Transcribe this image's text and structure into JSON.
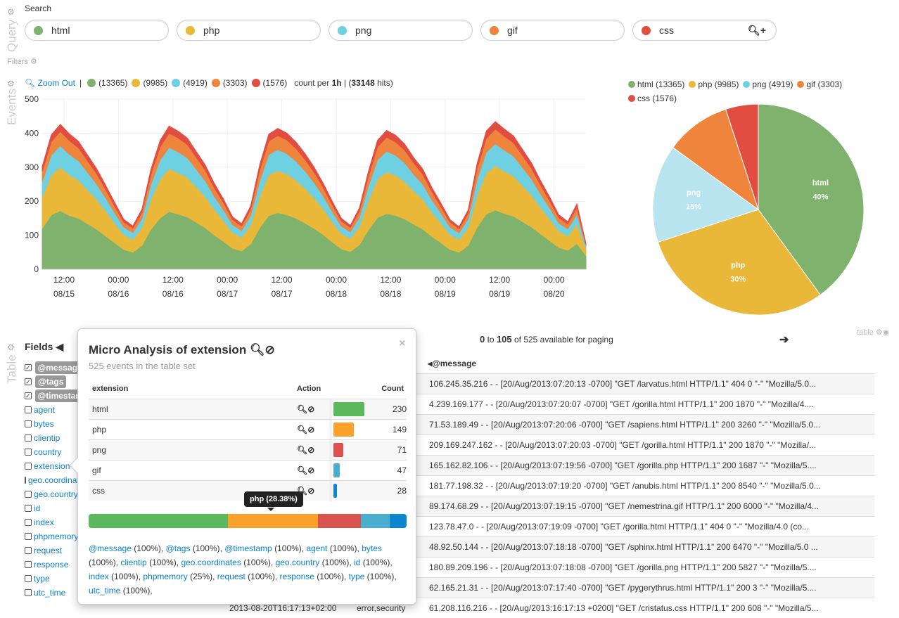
{
  "query": {
    "label": "Query",
    "search_label": "Search",
    "filters_label": "Filters",
    "pills": [
      {
        "text": "html",
        "color": "#7eb26d"
      },
      {
        "text": "php",
        "color": "#eab839"
      },
      {
        "text": "png",
        "color": "#6ed0e0"
      },
      {
        "text": "gif",
        "color": "#ef843c"
      },
      {
        "text": "css",
        "color": "#e24d42"
      }
    ]
  },
  "events": {
    "label": "Events",
    "zoom_out": "Zoom Out",
    "counts": [
      "(13365)",
      "(9985)",
      "(4919)",
      "(3303)",
      "(1576)"
    ],
    "count_per": "count per ",
    "interval": "1h",
    "hits_pre": "(",
    "hits": "33148",
    "hits_post": " hits)"
  },
  "chart_data": [
    {
      "type": "area",
      "stacked": true,
      "interval": "1h",
      "ylim": [
        0,
        500
      ],
      "yticks": [
        0,
        100,
        200,
        300,
        400,
        500
      ],
      "xticks": [
        [
          "12:00",
          "08/15"
        ],
        [
          "00:00",
          "08/16"
        ],
        [
          "12:00",
          "08/16"
        ],
        [
          "00:00",
          "08/17"
        ],
        [
          "12:00",
          "08/17"
        ],
        [
          "00:00",
          "08/18"
        ],
        [
          "12:00",
          "08/18"
        ],
        [
          "00:00",
          "08/19"
        ],
        [
          "12:00",
          "08/19"
        ],
        [
          "00:00",
          "08/20"
        ]
      ],
      "grid": true,
      "x_start": "08/15 07:00",
      "x_step_hours": 2,
      "series": [
        {
          "name": "html",
          "color": "#7eb26d",
          "values": [
            120,
            160,
            172,
            158,
            150,
            134,
            118,
            98,
            78,
            58,
            50,
            70,
            118,
            150,
            170,
            162,
            154,
            138,
            122,
            100,
            82,
            62,
            54,
            74,
            122,
            158,
            166,
            160,
            150,
            136,
            120,
            102,
            80,
            60,
            52,
            72,
            116,
            152,
            164,
            158,
            148,
            132,
            118,
            96,
            78,
            58,
            50,
            70,
            124,
            162,
            174,
            164,
            156,
            140,
            124,
            104,
            84,
            64,
            56,
            76,
            40
          ]
        },
        {
          "name": "php",
          "color": "#eab839",
          "values": [
            92,
            118,
            128,
            120,
            112,
            100,
            88,
            74,
            58,
            44,
            38,
            52,
            88,
            114,
            126,
            122,
            116,
            104,
            92,
            76,
            62,
            46,
            40,
            56,
            92,
            120,
            124,
            120,
            112,
            102,
            90,
            76,
            60,
            45,
            39,
            54,
            86,
            114,
            122,
            118,
            110,
            98,
            88,
            72,
            58,
            44,
            38,
            52,
            94,
            122,
            130,
            124,
            118,
            106,
            94,
            78,
            64,
            48,
            42,
            58,
            20
          ]
        },
        {
          "name": "png",
          "color": "#6ed0e0",
          "values": [
            45,
            58,
            63,
            60,
            57,
            51,
            45,
            38,
            30,
            22,
            20,
            27,
            44,
            57,
            62,
            61,
            58,
            52,
            46,
            38,
            31,
            23,
            20,
            28,
            46,
            59,
            62,
            60,
            56,
            51,
            45,
            38,
            30,
            22,
            19,
            27,
            43,
            56,
            61,
            59,
            55,
            49,
            44,
            36,
            29,
            22,
            19,
            26,
            47,
            60,
            65,
            62,
            59,
            53,
            47,
            39,
            32,
            24,
            21,
            29,
            8
          ]
        },
        {
          "name": "gif",
          "color": "#ef843c",
          "values": [
            30,
            39,
            42,
            40,
            38,
            34,
            30,
            25,
            20,
            15,
            13,
            18,
            29,
            38,
            42,
            41,
            39,
            35,
            31,
            25,
            21,
            15,
            13,
            19,
            31,
            40,
            41,
            40,
            37,
            34,
            30,
            25,
            20,
            15,
            13,
            18,
            29,
            38,
            41,
            39,
            37,
            33,
            29,
            24,
            19,
            15,
            12,
            17,
            31,
            41,
            43,
            41,
            39,
            35,
            31,
            26,
            21,
            16,
            14,
            19,
            5
          ]
        },
        {
          "name": "css",
          "color": "#e24d42",
          "values": [
            15,
            20,
            21,
            20,
            19,
            17,
            15,
            12,
            10,
            8,
            6,
            9,
            15,
            19,
            21,
            20,
            19,
            17,
            15,
            13,
            10,
            8,
            7,
            9,
            16,
            20,
            21,
            20,
            19,
            17,
            15,
            12,
            10,
            8,
            6,
            9,
            14,
            19,
            20,
            20,
            18,
            16,
            15,
            12,
            10,
            7,
            6,
            9,
            16,
            21,
            22,
            21,
            20,
            18,
            16,
            13,
            11,
            8,
            7,
            10,
            3
          ]
        }
      ]
    },
    {
      "type": "pie",
      "legend": [
        "html (13365)",
        "php (9985)",
        "png (4919)",
        "gif (3303)",
        "css (1576)"
      ],
      "slices": [
        {
          "name": "html",
          "value": 40,
          "label": "40%",
          "color": "#7eb26d"
        },
        {
          "name": "php",
          "value": 30,
          "label": "30%",
          "color": "#eab839"
        },
        {
          "name": "png",
          "value": 15,
          "label": "15%",
          "color": "#b7e4ee"
        },
        {
          "name": "gif",
          "value": 10,
          "label": "",
          "color": "#ef843c"
        },
        {
          "name": "css",
          "value": 5,
          "label": "",
          "color": "#e24d42"
        }
      ]
    }
  ],
  "table": {
    "label": "Table",
    "fields_title": "Fields",
    "paging_from": "0",
    "paging_to": "to",
    "paging_end": "105",
    "paging_rest": " of 525 available for paging",
    "panel_label": "table",
    "selected_fields": [
      "@message",
      "@tags",
      "@timestamp"
    ],
    "fields": [
      "agent",
      "bytes",
      "clientip",
      "country",
      "extension",
      "geo.coordinates",
      "geo.country",
      "id",
      "index",
      "phpmemory",
      "request",
      "response",
      "type",
      "utc_time"
    ],
    "message_header": "@message",
    "rows": [
      {
        "msg": "106.245.35.216 - - [20/Aug/2013:07:20:13 -0700] \"GET /larvatus.html HTTP/1.1\" 404 0 \"-\" \"Mozilla/5.0..."
      },
      {
        "msg": "4.239.169.177 - - [20/Aug/2013:07:20:07 -0700] \"GET /gorilla.html HTTP/1.1\" 200 1870 \"-\" \"Mozilla/4...."
      },
      {
        "msg": "71.53.189.49 - - [20/Aug/2013:07:20:06 -0700] \"GET /sapiens.html HTTP/1.1\" 200 3260 \"-\" \"Mozilla/5.0..."
      },
      {
        "msg": "209.169.247.162 - - [20/Aug/2013:07:20:03 -0700] \"GET /gorilla.html HTTP/1.1\" 200 1870 \"-\" \"Mozilla/..."
      },
      {
        "msg": "165.162.82.106 - - [20/Aug/2013:07:19:56 -0700] \"GET /gorilla.php HTTP/1.1\" 200 1687 \"-\" \"Mozilla/5...."
      },
      {
        "msg": "181.77.198.32 - - [20/Aug/2013:07:19:20 -0700] \"GET /anubis.html HTTP/1.1\" 200 8540 \"-\" \"Mozilla/5.0..."
      },
      {
        "msg": "89.174.68.29 - - [20/Aug/2013:07:19:15 -0700] \"GET /nemestrina.gif HTTP/1.1\" 200 6000 \"-\" \"Mozilla/4..."
      },
      {
        "msg": "123.78.47.0 - - [20/Aug/2013:07:19:09 -0700] \"GET /gorilla.html HTTP/1.1\" 404 0 \"-\" \"Mozilla/4.0 (co..."
      },
      {
        "msg": "48.92.50.144 - - [20/Aug/2013:07:18:18 -0700] \"GET /sphinx.html HTTP/1.1\" 200 6470 \"-\" \"Mozilla/5.0 ..."
      },
      {
        "msg": "180.89.209.196 - - [20/Aug/2013:07:18:08 -0700] \"GET /gorilla.png HTTP/1.1\" 200 5827 \"-\" \"Mozilla/5...."
      },
      {
        "msg": "62.165.21.31 - - [20/Aug/2013:07:17:40 -0700] \"GET /pygerythrus.html HTTP/1.1\" 200 3 \"-\" \"Mozilla/5...."
      },
      {
        "ts": "2013-08-20T16:17:13+02:00",
        "tags": "error,security",
        "msg": "61.208.116.216 - - [20/Aug/2013:16:17:13 +0200] \"GET /cristatus.css HTTP/1.1\" 200 608 \"-\" \"Mozilla/5..."
      }
    ]
  },
  "micro": {
    "title": "Micro Analysis of extension",
    "subtitle": "525 events in the table set",
    "col_field": "extension",
    "col_action": "Action",
    "col_count": "Count",
    "rows": [
      {
        "name": "html",
        "count": 230,
        "color": "#5cb85c"
      },
      {
        "name": "php",
        "count": 149,
        "color": "#f9a12a"
      },
      {
        "name": "png",
        "count": 71,
        "color": "#d9534f"
      },
      {
        "name": "gif",
        "count": 47,
        "color": "#4aaed1"
      },
      {
        "name": "css",
        "count": 28,
        "color": "#0b86cf"
      }
    ],
    "tooltip": "php (28.38%)",
    "fields": [
      [
        "@message",
        "(100%),"
      ],
      [
        "@tags",
        "(100%),"
      ],
      [
        "@timestamp",
        "(100%),"
      ],
      [
        "agent",
        "(100%),"
      ],
      [
        "bytes",
        "(100%),"
      ],
      [
        "clientip",
        "(100%),"
      ],
      [
        "geo.coordinates",
        "(100%),"
      ],
      [
        "geo.country",
        "(100%),"
      ],
      [
        "id",
        "(100%),"
      ],
      [
        "index",
        "(100%),"
      ],
      [
        "phpmemory",
        "(25%),"
      ],
      [
        "request",
        "(100%),"
      ],
      [
        "response",
        "(100%),"
      ],
      [
        "type",
        "(100%),"
      ],
      [
        "utc_time",
        "(100%),"
      ]
    ]
  }
}
